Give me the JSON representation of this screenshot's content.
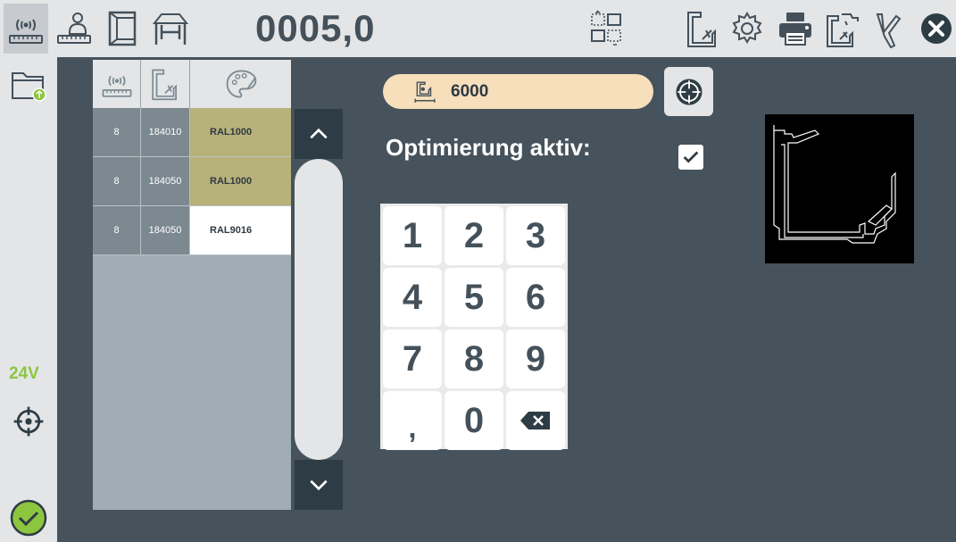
{
  "topbar": {
    "counter": "0005,0",
    "buttons": [
      {
        "name": "measure-sensor-icon"
      },
      {
        "name": "operator-measure-icon"
      },
      {
        "name": "window-frame-icon"
      },
      {
        "name": "machine-table-icon"
      },
      {
        "name": "transfer-icon"
      },
      {
        "name": "profile-cut-icon"
      },
      {
        "name": "gear-icon"
      },
      {
        "name": "printer-icon"
      },
      {
        "name": "profile-edit-icon"
      },
      {
        "name": "profile-angle-icon"
      },
      {
        "name": "close-icon"
      }
    ]
  },
  "sidebar": {
    "voltage": "24V"
  },
  "table": {
    "rows": [
      {
        "qty": "8",
        "profile": "184010",
        "color": "RAL1000",
        "color_bg": "#b7b17a"
      },
      {
        "qty": "8",
        "profile": "184050",
        "color": "RAL1000",
        "color_bg": "#b7b17a"
      },
      {
        "qty": "8",
        "profile": "184050",
        "color": "RAL9016",
        "color_bg": "#ffffff"
      }
    ]
  },
  "length": {
    "value": "6000"
  },
  "optimization": {
    "label": "Optimierung aktiv:",
    "checked": true
  },
  "numpad": {
    "keys": [
      "1",
      "2",
      "3",
      "4",
      "5",
      "6",
      "7",
      "8",
      "9",
      ",",
      "0",
      "⌫"
    ]
  },
  "colors": {
    "background": "#46535d",
    "panel": "#e3e5e7",
    "accent_green": "#8cc63e",
    "length_field": "#f7dfbb",
    "close": "#2e3c45"
  }
}
